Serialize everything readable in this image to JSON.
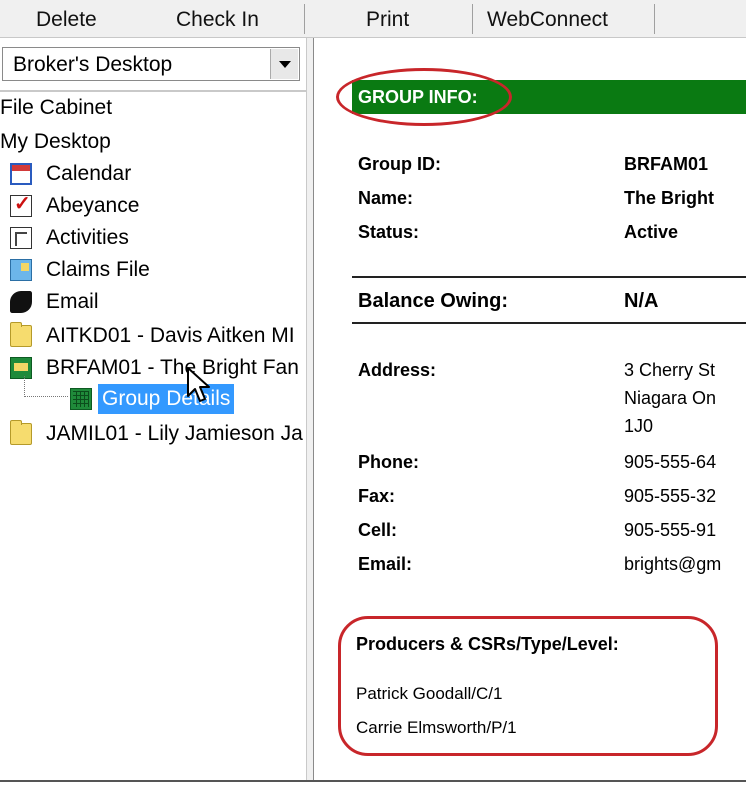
{
  "toolbar": {
    "delete": "Delete",
    "check_in": "Check In",
    "print": "Print",
    "webconnect": "WebConnect"
  },
  "left": {
    "dropdown_value": "Broker's Desktop",
    "tree": [
      {
        "label": "File Cabinet",
        "icon": "none"
      },
      {
        "label": "My Desktop",
        "icon": "none"
      },
      {
        "label": "Calendar",
        "icon": "calendar-icon"
      },
      {
        "label": "Abeyance",
        "icon": "checklist-icon"
      },
      {
        "label": "Activities",
        "icon": "activities-icon"
      },
      {
        "label": "Claims File",
        "icon": "claims-file-icon"
      },
      {
        "label": "Email",
        "icon": "email-icon"
      },
      {
        "label": "AITKD01 - Davis Aitken MI",
        "icon": "folder-icon"
      },
      {
        "label": "BRFAM01 - The Bright Fan",
        "icon": "open-folder-icon"
      },
      {
        "label": "JAMIL01 - Lily Jamieson Ja",
        "icon": "folder-icon"
      }
    ],
    "selected_child": {
      "label": "Group Details",
      "icon": "grid-icon"
    }
  },
  "group": {
    "header": "GROUP INFO:",
    "fields": {
      "group_id": {
        "label": "Group ID:",
        "value": "BRFAM01"
      },
      "name": {
        "label": "Name:",
        "value": "The Bright"
      },
      "status": {
        "label": "Status:",
        "value": "Active"
      },
      "balance": {
        "label": "Balance Owing:",
        "value": "N/A"
      },
      "address": {
        "label": "Address:",
        "lines": [
          "3 Cherry St",
          "Niagara On",
          "1J0"
        ]
      },
      "phone": {
        "label": "Phone:",
        "value": "905-555-64"
      },
      "fax": {
        "label": "Fax:",
        "value": "905-555-32"
      },
      "cell": {
        "label": "Cell:",
        "value": "905-555-91"
      },
      "email": {
        "label": "Email:",
        "value": "brights@gm"
      }
    },
    "producers_title": "Producers & CSRs/Type/Level:",
    "producers": [
      "Patrick Goodall/C/1",
      "Carrie Elmsworth/P/1"
    ]
  },
  "colors": {
    "header_green": "#0a7a12",
    "highlight_oval": "#c8262a",
    "selection_blue": "#3399ff"
  }
}
